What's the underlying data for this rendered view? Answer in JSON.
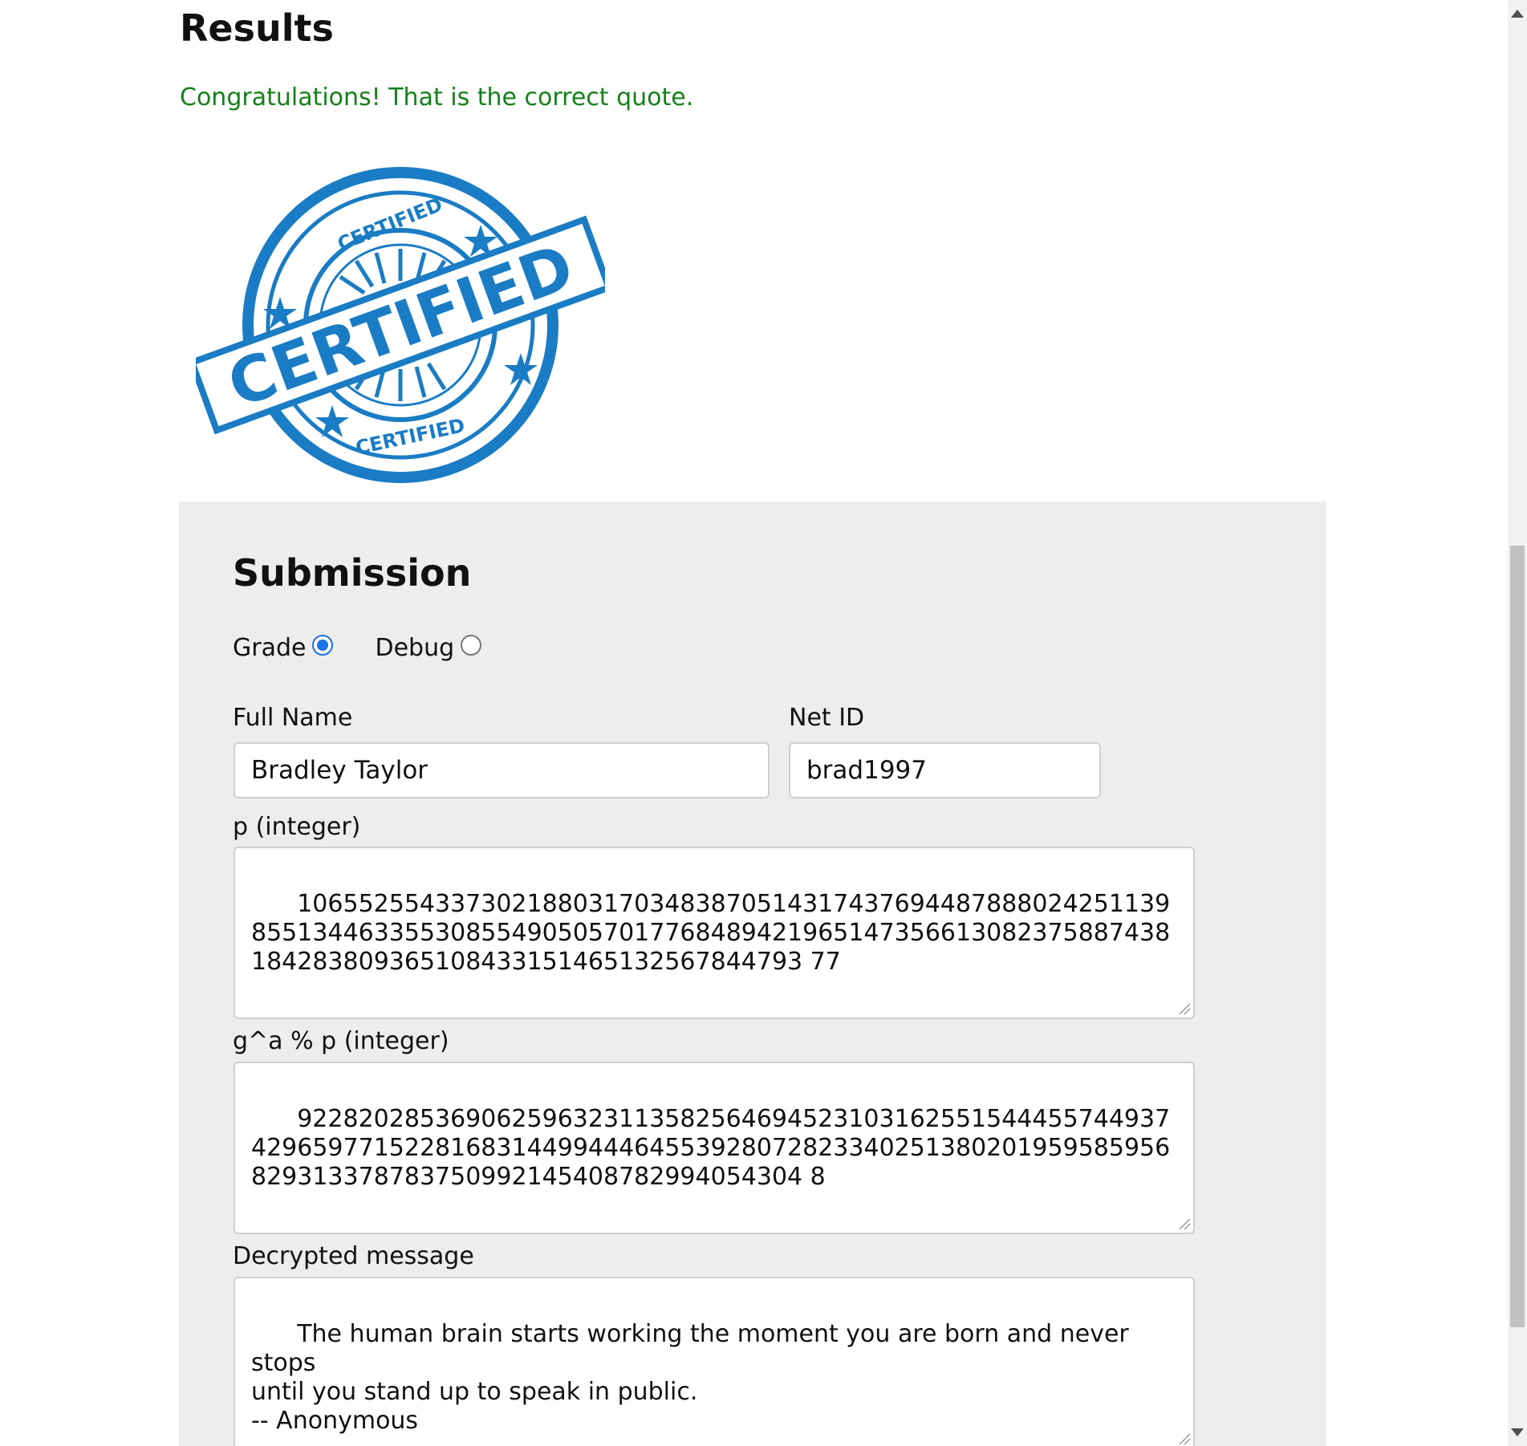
{
  "results": {
    "title": "Results",
    "message": "Congratulations! That is the correct quote.",
    "stamp_text": "CERTIFIED",
    "stamp_ring_text_top": "CERTIFIED",
    "stamp_ring_text_bottom": "CERTIFIED",
    "stamp_color": "#1a7cc4"
  },
  "submission": {
    "title": "Submission",
    "mode_options": [
      {
        "label": "Grade",
        "checked": true
      },
      {
        "label": "Debug",
        "checked": false
      }
    ],
    "full_name": {
      "label": "Full Name",
      "value": "Bradley Taylor"
    },
    "net_id": {
      "label": "Net ID",
      "value": "brad1997"
    },
    "p": {
      "label": "p (integer)",
      "value": "106552554337302188031703483870514317437694487888024251139855134463355308554905057017768489421965147356613082375887438184283809365108433151465132567844793 77"
    },
    "gap": {
      "label": "g^a % p (integer)",
      "value": "922820285369062596323113582564694523103162551544455744937429659771522816831449944464553928072823340251380201959585956829313378783750992145408782994054304 8"
    },
    "decrypted": {
      "label": "Decrypted message",
      "value": "The human brain starts working the moment you are born and never stops\nuntil you stand up to speak in public.\n-- Anonymous"
    }
  },
  "colors": {
    "success_text": "#15801a",
    "panel_bg": "#ededed",
    "radio_accent": "#1a73e8"
  }
}
